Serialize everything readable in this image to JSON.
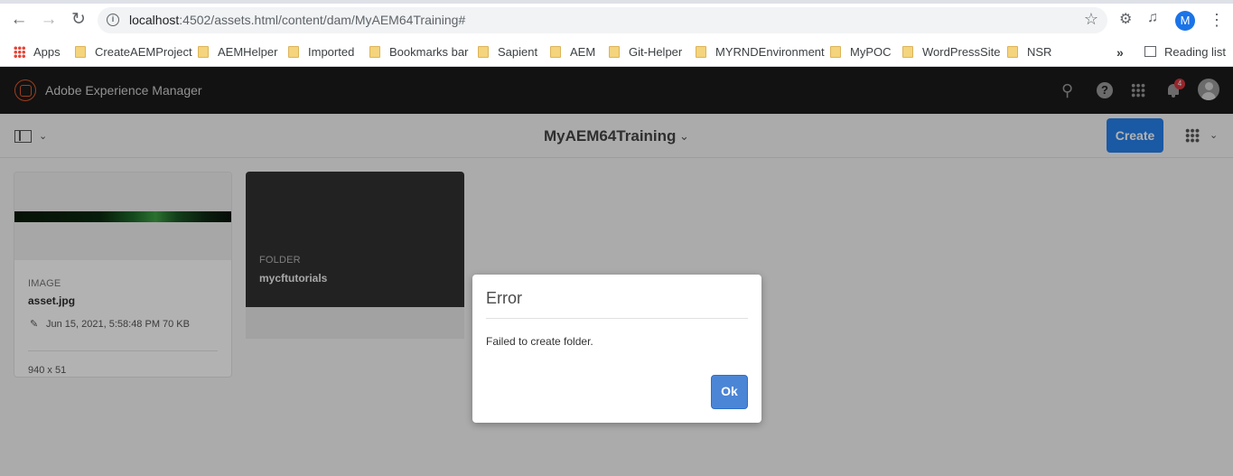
{
  "browser": {
    "url_host": "localhost",
    "url_path": ":4502/assets.html/content/dam/MyAEM64Training#",
    "profile_initial": "M",
    "bookmarks": [
      {
        "label": "Apps",
        "icon": "apps-grid-icon"
      },
      {
        "label": "CreateAEMProject",
        "icon": "folder-icon"
      },
      {
        "label": "AEMHelper",
        "icon": "folder-icon"
      },
      {
        "label": "Imported",
        "icon": "folder-icon"
      },
      {
        "label": "Bookmarks bar",
        "icon": "folder-icon"
      },
      {
        "label": "Sapient",
        "icon": "folder-icon"
      },
      {
        "label": "AEM",
        "icon": "folder-icon"
      },
      {
        "label": "Git-Helper",
        "icon": "folder-icon"
      },
      {
        "label": "MYRNDEnvironment",
        "icon": "folder-icon"
      },
      {
        "label": "MyPOC",
        "icon": "folder-icon"
      },
      {
        "label": "WordPressSite",
        "icon": "folder-icon"
      },
      {
        "label": "NSR",
        "icon": "folder-icon"
      }
    ],
    "overflow_label": "»",
    "reading_list_label": "Reading list"
  },
  "aem": {
    "product_name": "Adobe Experience Manager",
    "notification_count": "4",
    "breadcrumb_title": "MyAEM64Training",
    "create_label": "Create",
    "assets": [
      {
        "type": "IMAGE",
        "name": "asset.jpg",
        "modified": "Jun 15, 2021, 5:58:48 PM",
        "size": "70 KB",
        "dimensions": "940 x 51"
      },
      {
        "type": "FOLDER",
        "name": "mycftutorials"
      }
    ]
  },
  "dialog": {
    "title": "Error",
    "message": "Failed to create folder.",
    "ok_label": "Ok"
  },
  "colors": {
    "aem_header_bg": "#1b1b1b",
    "create_button": "#2680eb",
    "ok_button": "#4b85d6",
    "notification_badge": "#d7373f",
    "profile_avatar": "#1a73e8"
  }
}
